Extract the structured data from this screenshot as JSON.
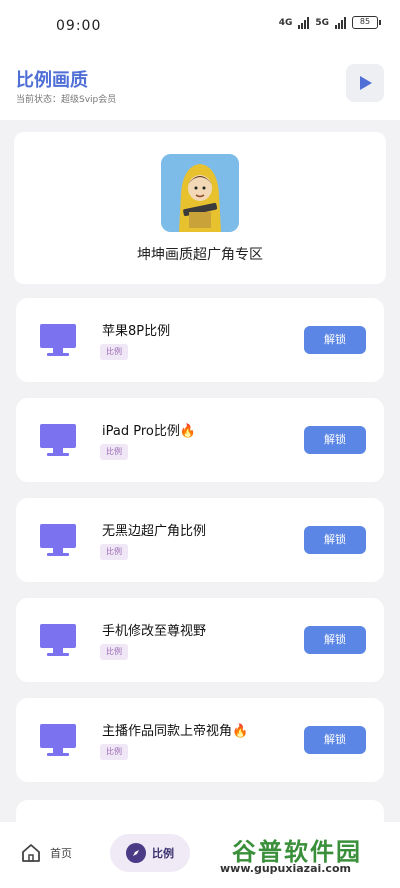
{
  "status_bar": {
    "time": "09:00",
    "network_1": "4G",
    "network_2": "5G",
    "battery": "85"
  },
  "header": {
    "title": "比例画质",
    "subtitle": "当前状态：超级Svip会员",
    "play_icon": "play-icon"
  },
  "banner": {
    "title": "坤坤画质超广角专区"
  },
  "cards": [
    {
      "title": "苹果8P比例",
      "tag": "比例",
      "button": "解锁"
    },
    {
      "title": "iPad Pro比例🔥",
      "tag": "比例",
      "button": "解锁"
    },
    {
      "title": "无黑边超广角比例",
      "tag": "比例",
      "button": "解锁"
    },
    {
      "title": "手机修改至尊视野",
      "tag": "比例",
      "button": "解锁"
    },
    {
      "title": "主播作品同款上帝视角🔥",
      "tag": "比例",
      "button": "解锁"
    }
  ],
  "bottom_nav": {
    "home_label": "首页",
    "ratio_label": "比例"
  },
  "watermark": {
    "text": "谷普软件园",
    "url": "www.gupuxiazai.com"
  },
  "colors": {
    "accent": "#4f6fd6",
    "button": "#5b86e5",
    "monitor": "#7b72f0",
    "tag_bg": "#efe6f6"
  }
}
